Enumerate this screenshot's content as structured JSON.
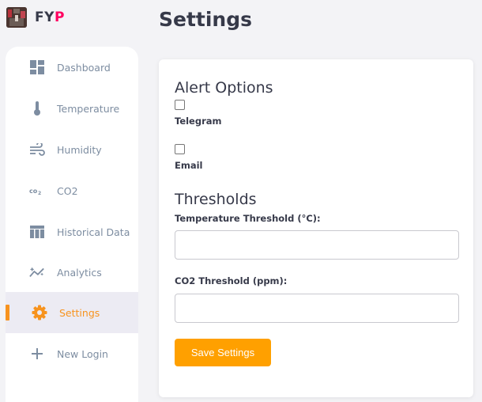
{
  "brand": {
    "logo_icon": "project-logo-image",
    "name_prefix": "FY",
    "name_accent": "P",
    "accent_color": "#ff0060"
  },
  "page": {
    "title": "Settings"
  },
  "sidebar": {
    "accent_color": "#f7931e",
    "items": [
      {
        "label": "Dashboard",
        "icon": "dashboard-icon",
        "active": false
      },
      {
        "label": "Temperature",
        "icon": "thermometer-icon",
        "active": false
      },
      {
        "label": "Humidity",
        "icon": "wind-icon",
        "active": false
      },
      {
        "label": "CO2",
        "icon": "co2-icon",
        "active": false
      },
      {
        "label": "Historical Data",
        "icon": "table-icon",
        "active": false
      },
      {
        "label": "Analytics",
        "icon": "analytics-icon",
        "active": false
      },
      {
        "label": "Settings",
        "icon": "gear-icon",
        "active": true
      },
      {
        "label": "New Login",
        "icon": "plus-icon",
        "active": false
      }
    ]
  },
  "settings": {
    "alert_options": {
      "title": "Alert Options",
      "telegram": {
        "label": "Telegram",
        "checked": false
      },
      "email": {
        "label": "Email",
        "checked": false
      }
    },
    "thresholds": {
      "title": "Thresholds",
      "temperature": {
        "label": "Temperature Threshold (°C):",
        "value": ""
      },
      "co2": {
        "label": "CO2 Threshold (ppm):",
        "value": ""
      }
    },
    "save_label": "Save Settings",
    "save_color": "#ffa000"
  }
}
